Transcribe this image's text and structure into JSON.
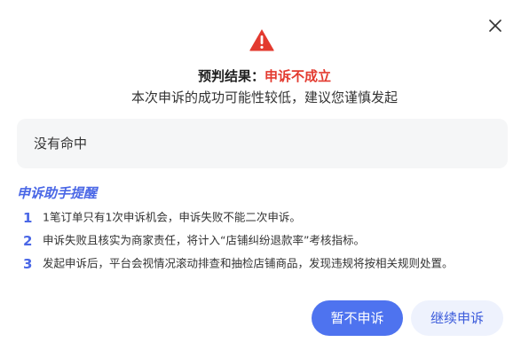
{
  "dialog": {
    "icons": {
      "close": "close-icon",
      "warning": "warning-triangle-icon"
    },
    "result_label": "预判结果：",
    "result_value": "申诉不成立",
    "subtitle": "本次申诉的成功可能性较低，建议您谨慎发起",
    "match_text": "没有命中",
    "tips_title": "申诉助手提醒",
    "tips": [
      {
        "num": "1",
        "text": "1笔订单只有1次申诉机会，申诉失败不能二次申诉。"
      },
      {
        "num": "2",
        "text": "申诉失败且核实为商家责任，将计入“店铺纠纷退款率”考核指标。"
      },
      {
        "num": "3",
        "text": "发起申诉后，平台会视情况滚动排查和抽检店铺商品，发现违规将按相关规则处置。"
      }
    ],
    "buttons": {
      "cancel": "暂不申诉",
      "continue": "继续申诉"
    },
    "colors": {
      "accent": "#4e73ef",
      "danger": "#e33a2f",
      "tip_blue": "#4a67e6"
    }
  }
}
